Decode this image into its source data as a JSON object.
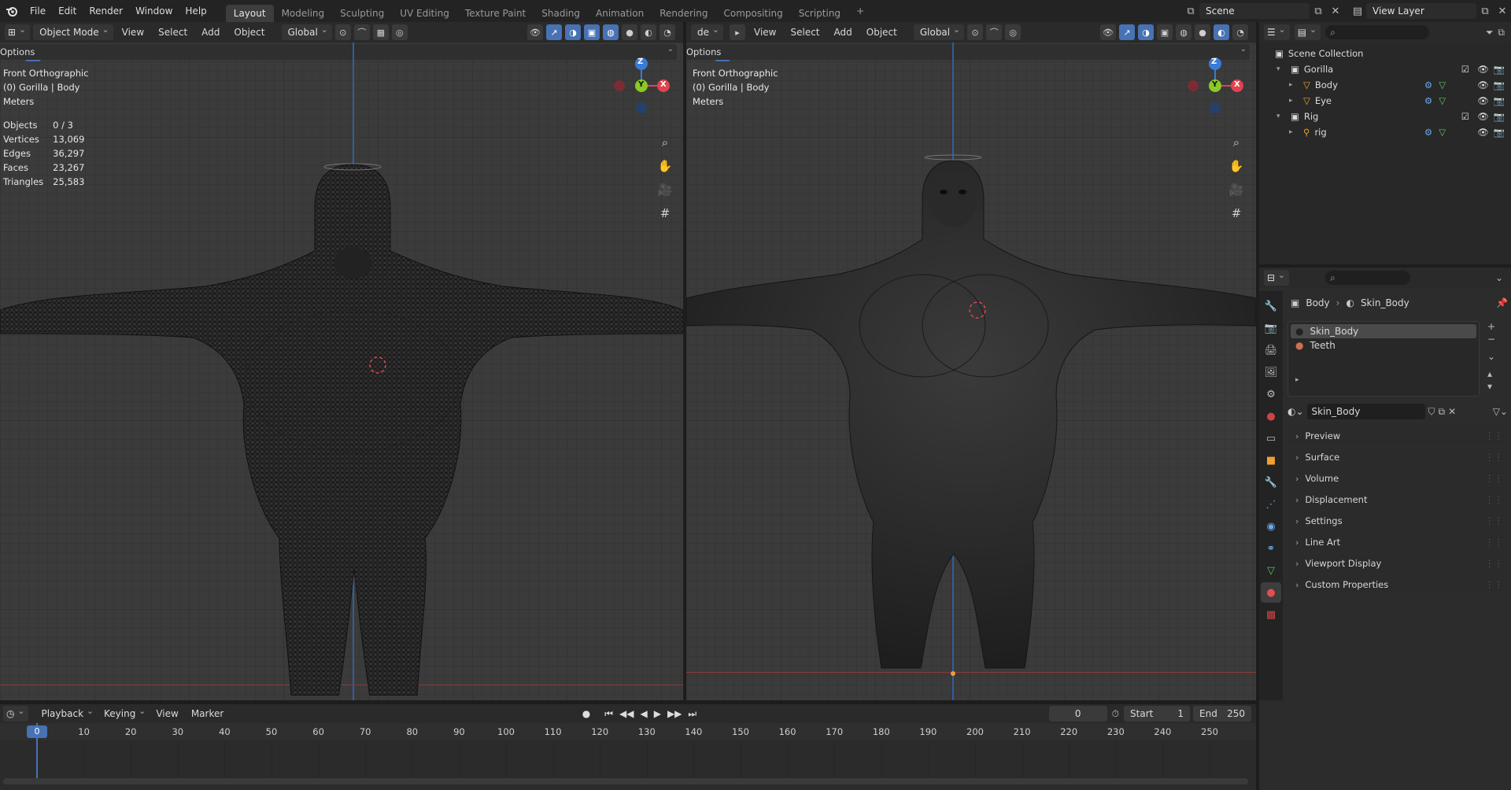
{
  "topbar": {
    "menus": [
      "File",
      "Edit",
      "Render",
      "Window",
      "Help"
    ],
    "workspaces": [
      "Layout",
      "Modeling",
      "Sculpting",
      "UV Editing",
      "Texture Paint",
      "Shading",
      "Animation",
      "Rendering",
      "Compositing",
      "Scripting"
    ],
    "active_workspace": "Layout",
    "add_tab": "+",
    "scene_name": "Scene",
    "view_layer": "View Layer"
  },
  "viewport_left": {
    "mode": "Object Mode",
    "menus": [
      "View",
      "Select",
      "Add",
      "Object"
    ],
    "orientation": "Global",
    "options": "Options",
    "info": {
      "view": "Front Orthographic",
      "object": "(0) Gorilla | Body",
      "units": "Meters"
    },
    "stats": [
      {
        "label": "Objects",
        "value": "0 / 3"
      },
      {
        "label": "Vertices",
        "value": "13,069"
      },
      {
        "label": "Edges",
        "value": "36,297"
      },
      {
        "label": "Faces",
        "value": "23,267"
      },
      {
        "label": "Triangles",
        "value": "25,583"
      }
    ]
  },
  "viewport_right": {
    "mode_partial": "de",
    "menus": [
      "View",
      "Select",
      "Add",
      "Object"
    ],
    "orientation": "Global",
    "options": "Options",
    "info": {
      "view": "Front Orthographic",
      "object": "(0) Gorilla | Body",
      "units": "Meters"
    }
  },
  "gizmo": {
    "z": "Z",
    "y": "Y",
    "x": "X"
  },
  "outliner": {
    "root": "Scene Collection",
    "items": [
      {
        "name": "Gorilla",
        "level": 1,
        "type": "collection"
      },
      {
        "name": "Body",
        "level": 2,
        "type": "mesh"
      },
      {
        "name": "Eye",
        "level": 2,
        "type": "mesh"
      },
      {
        "name": "Rig",
        "level": 1,
        "type": "collection"
      },
      {
        "name": "rig",
        "level": 2,
        "type": "armature"
      }
    ]
  },
  "properties": {
    "breadcrumb": [
      "Body",
      "Skin_Body"
    ],
    "material_slots": [
      "Skin_Body",
      "Teeth"
    ],
    "active_material": "Skin_Body",
    "panels": [
      "Preview",
      "Surface",
      "Volume",
      "Displacement",
      "Settings",
      "Line Art",
      "Viewport Display",
      "Custom Properties"
    ]
  },
  "timeline": {
    "menus": [
      "Playback",
      "Keying",
      "View",
      "Marker"
    ],
    "current_frame": "0",
    "start_label": "Start",
    "start": "1",
    "end_label": "End",
    "end": "250",
    "ticks": [
      "0",
      "10",
      "20",
      "30",
      "40",
      "50",
      "60",
      "70",
      "80",
      "90",
      "100",
      "110",
      "120",
      "130",
      "140",
      "150",
      "160",
      "170",
      "180",
      "190",
      "200",
      "210",
      "220",
      "230",
      "240",
      "250"
    ]
  },
  "colors": {
    "accent_blue": "#4772b3",
    "axis_x": "#e04350",
    "axis_y": "#8ac926",
    "axis_z": "#3a7bd5"
  }
}
